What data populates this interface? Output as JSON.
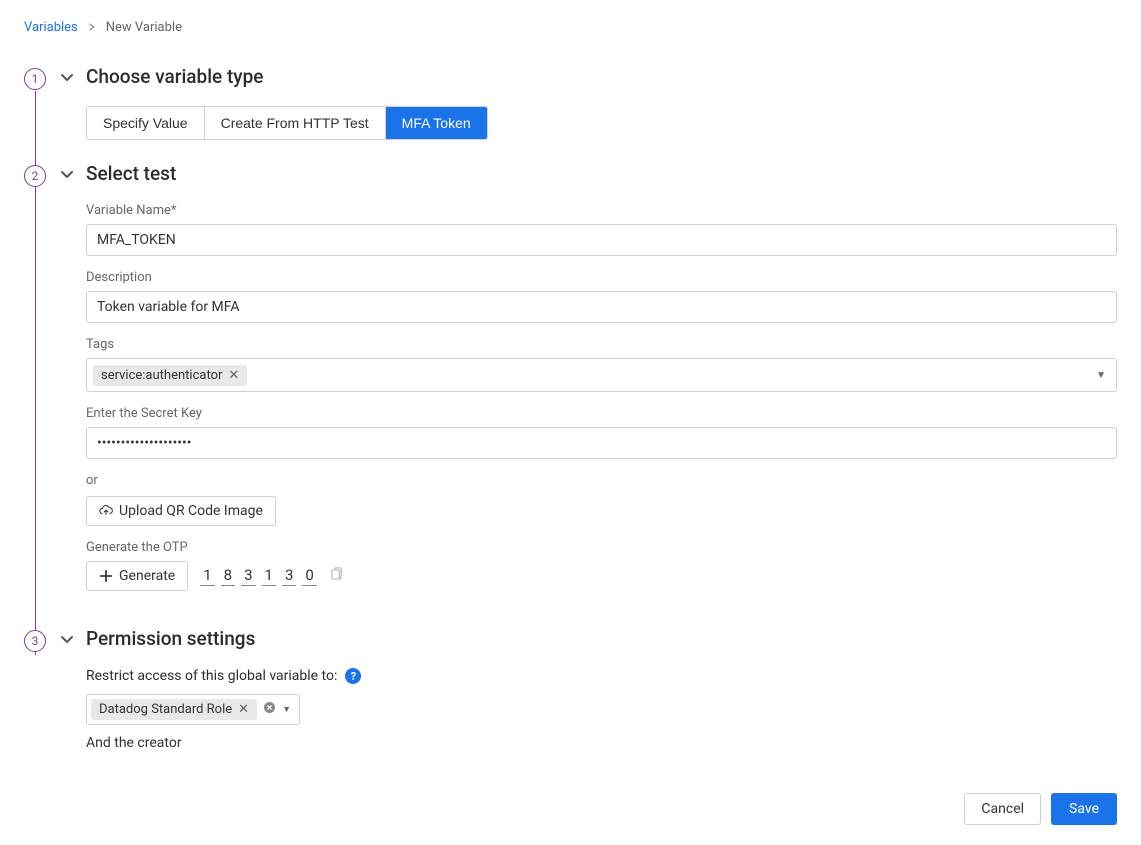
{
  "breadcrumb": {
    "parent": "Variables",
    "current": "New Variable"
  },
  "steps": {
    "step1": {
      "number": "1",
      "title": "Choose variable type",
      "tabs": {
        "specify": "Specify Value",
        "http": "Create From HTTP Test",
        "mfa": "MFA Token"
      }
    },
    "step2": {
      "number": "2",
      "title": "Select test",
      "labels": {
        "name": "Variable Name*",
        "description": "Description",
        "tags": "Tags",
        "secret": "Enter the Secret Key",
        "or": "or",
        "upload": "Upload QR Code Image",
        "generate_label": "Generate the OTP",
        "generate_btn": "Generate"
      },
      "values": {
        "name": "MFA_TOKEN",
        "description": "Token variable for MFA",
        "tag": "service:authenticator",
        "secret": "••••••••••••••••••••",
        "otp": [
          "1",
          "8",
          "3",
          "1",
          "3",
          "0"
        ]
      }
    },
    "step3": {
      "number": "3",
      "title": "Permission settings",
      "restrict_label": "Restrict access of this global variable to:",
      "role": "Datadog Standard Role",
      "creator": "And the creator"
    }
  },
  "footer": {
    "cancel": "Cancel",
    "save": "Save"
  }
}
